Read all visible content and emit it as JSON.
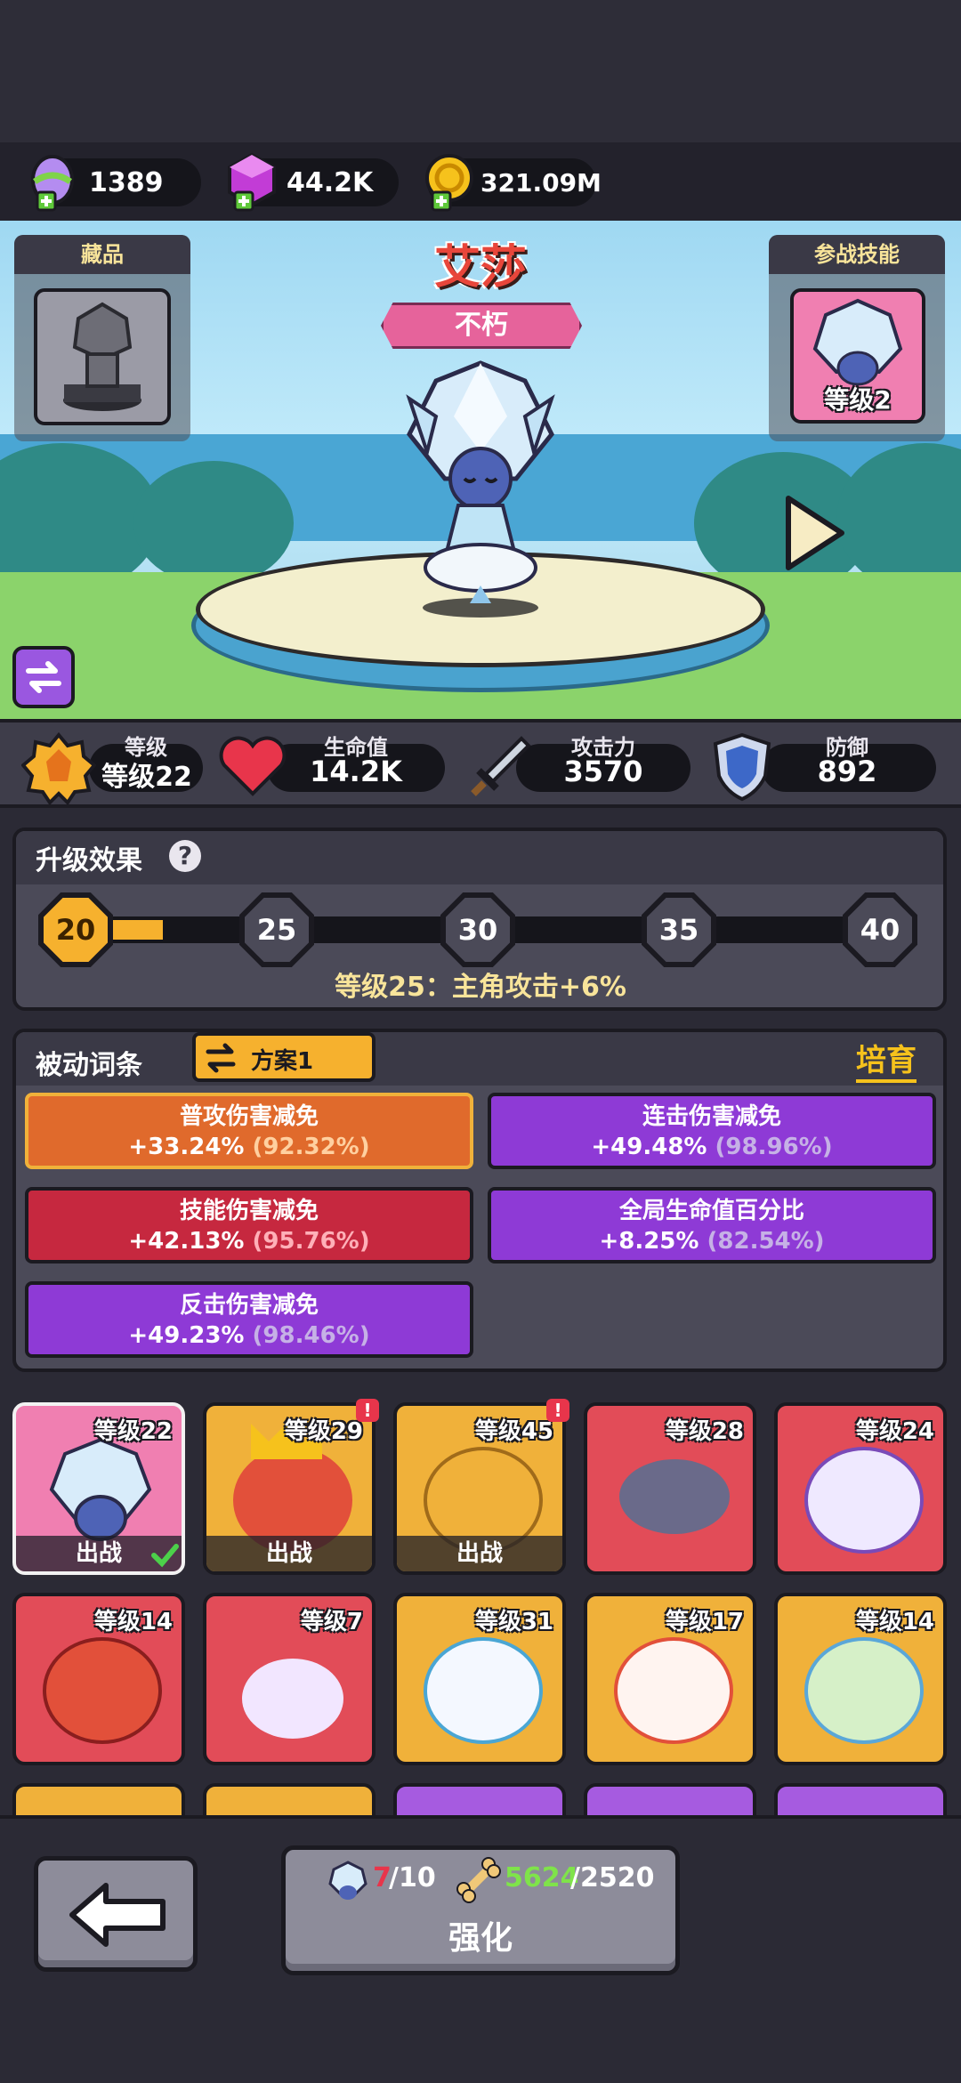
{
  "currencies": [
    {
      "icon": "egg-icon",
      "value": "1389"
    },
    {
      "icon": "gem-icon",
      "value": "44.2K"
    },
    {
      "icon": "coin-icon",
      "value": "321.09M"
    }
  ],
  "hero": {
    "name": "艾莎",
    "rank": "不朽"
  },
  "collection": {
    "title": "藏品"
  },
  "battle_skill": {
    "title": "参战技能",
    "level": "等级2"
  },
  "stats": [
    {
      "label": "等级",
      "value": "等级22",
      "icon": "level-badge-icon"
    },
    {
      "label": "生命值",
      "value": "14.2K",
      "icon": "heart-icon"
    },
    {
      "label": "攻击力",
      "value": "3570",
      "icon": "sword-icon"
    },
    {
      "label": "防御",
      "value": "892",
      "icon": "shield-icon"
    }
  ],
  "upgrade": {
    "title": "升级效果",
    "help": "?",
    "milestones": [
      "20",
      "25",
      "30",
      "35",
      "40"
    ],
    "progress": 0.12,
    "next_effect": "等级25：主角攻击+6%"
  },
  "passive": {
    "title": "被动词条",
    "plan_label": "方案1",
    "cultivate_label": "培育",
    "affixes": [
      {
        "name": "普攻伤害减免",
        "value": "+33.24%",
        "max": "(92.32%)",
        "tier": "orange"
      },
      {
        "name": "连击伤害减免",
        "value": "+49.48%",
        "max": "(98.96%)",
        "tier": "purple"
      },
      {
        "name": "技能伤害减免",
        "value": "+42.13%",
        "max": "(95.76%)",
        "tier": "red"
      },
      {
        "name": "全局生命值百分比",
        "value": "+8.25%",
        "max": "(82.54%)",
        "tier": "purple"
      },
      {
        "name": "反击伤害减免",
        "value": "+49.23%",
        "max": "(98.46%)",
        "tier": "purple"
      }
    ]
  },
  "heroes": [
    {
      "level": "等级22",
      "deployed": "出战",
      "color": "pink"
    },
    {
      "level": "等级29",
      "deployed": "出战",
      "color": "orange"
    },
    {
      "level": "等级45",
      "deployed": "出战",
      "color": "orange"
    },
    {
      "level": "等级28",
      "deployed": "",
      "color": "red"
    },
    {
      "level": "等级24",
      "deployed": "",
      "color": "red"
    },
    {
      "level": "等级14",
      "deployed": "",
      "color": "red"
    },
    {
      "level": "等级7",
      "deployed": "",
      "color": "red"
    },
    {
      "level": "等级31",
      "deployed": "",
      "color": "orange"
    },
    {
      "level": "等级17",
      "deployed": "",
      "color": "orange"
    },
    {
      "level": "等级14",
      "deployed": "",
      "color": "orange"
    }
  ],
  "bottom": {
    "shard_current": "7",
    "shard_total": "/10",
    "bone_current": "5624",
    "bone_total": "/2520",
    "enhance_label": "强化"
  },
  "colors": {
    "accent": "#f6b12e",
    "panel": "#4b4a58",
    "dark": "#1b1a21"
  }
}
